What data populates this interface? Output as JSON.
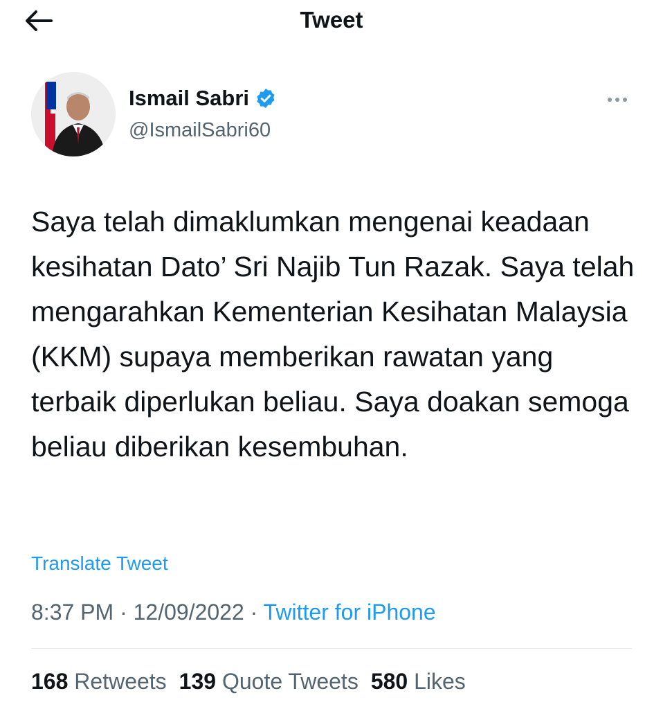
{
  "header": {
    "title": "Tweet",
    "back_icon": "arrow-left-icon"
  },
  "author": {
    "name": "Ismail Sabri",
    "handle": "@IsmailSabri60",
    "verified_icon": "verified-badge-icon",
    "verified_color": "#1d9bf0"
  },
  "tweet": {
    "text": "Saya telah dimaklumkan mengenai keadaan kesihatan Dato’ Sri Najib Tun Razak. Saya telah mengarahkan Kementerian Kesihatan Malaysia (KKM) supaya memberikan rawatan yang terbaik diperlukan beliau. Saya doakan semoga beliau diberikan kesembuhan.",
    "translate_label": "Translate Tweet",
    "time": "8:37 PM",
    "date": "12/09/2022",
    "separator": "·",
    "source": "Twitter for iPhone"
  },
  "stats": {
    "retweets_count": "168",
    "retweets_label": "Retweets",
    "quotes_count": "139",
    "quotes_label": "Quote Tweets",
    "likes_count": "580",
    "likes_label": "Likes"
  },
  "colors": {
    "accent": "#1d9bf0",
    "text_primary": "#0f1419",
    "text_secondary": "#536471"
  }
}
